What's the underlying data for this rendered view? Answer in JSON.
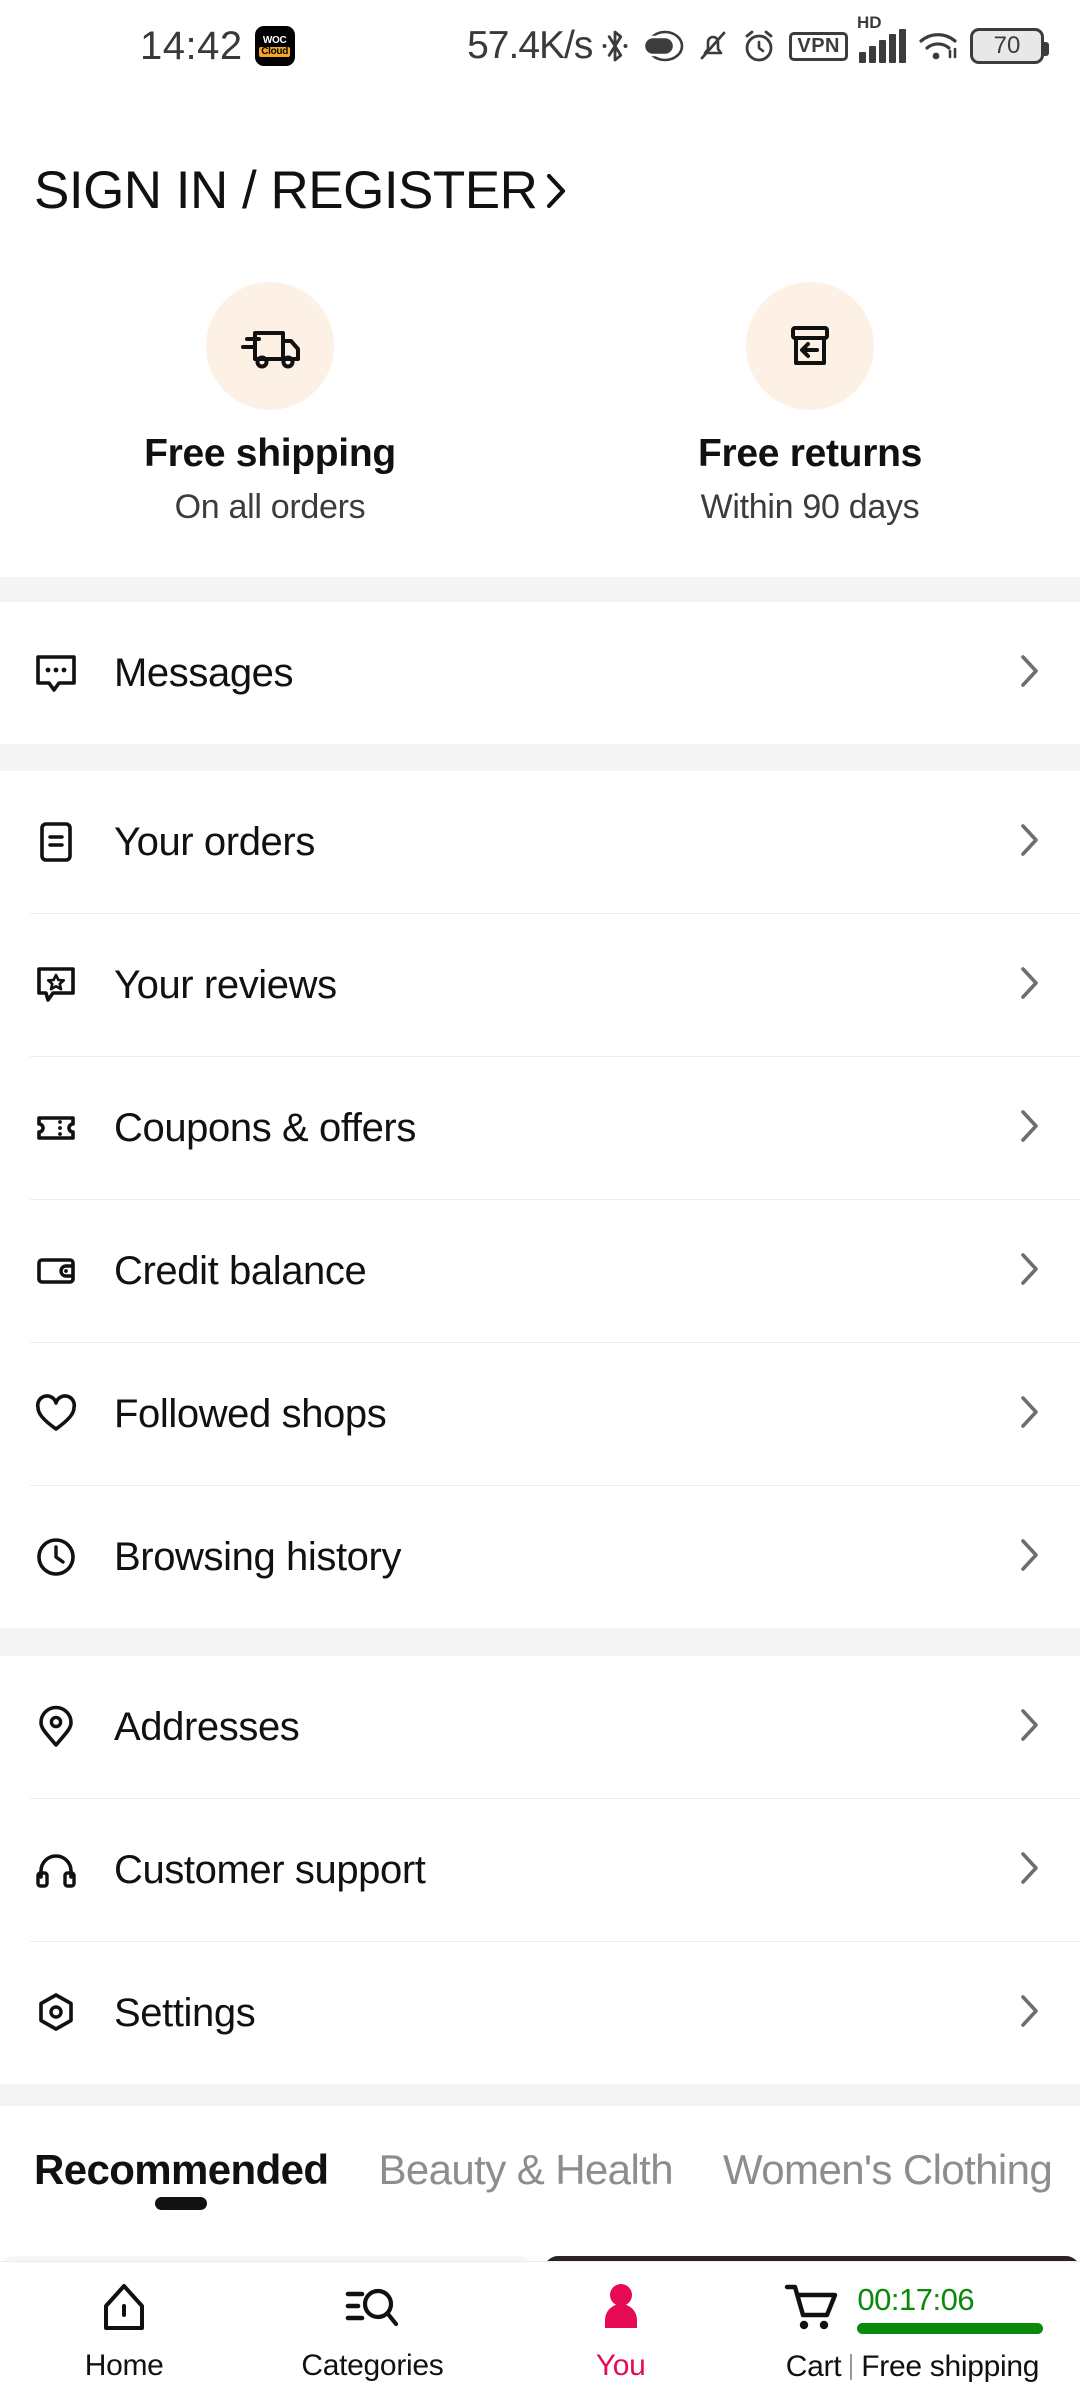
{
  "statusbar": {
    "time": "14:42",
    "badge_line1": "WOC",
    "badge_line2": "Cloud",
    "network_speed": "57.4K/s",
    "vpn_label": "VPN",
    "hd_label": "HD",
    "battery_level": "70",
    "icons": [
      "bluetooth-icon",
      "capsule-icon",
      "silent-bell-icon",
      "alarm-icon",
      "vpn-icon",
      "signal-icon",
      "wifi-icon",
      "battery-icon"
    ]
  },
  "header": {
    "sign_in_label": "SIGN IN / REGISTER"
  },
  "benefits": [
    {
      "icon": "delivery-truck-icon",
      "title": "Free shipping",
      "subtitle": "On all orders"
    },
    {
      "icon": "return-box-icon",
      "title": "Free returns",
      "subtitle": "Within 90 days"
    }
  ],
  "menu_groups": [
    {
      "items": [
        {
          "icon": "message-bubble-icon",
          "label": "Messages"
        }
      ]
    },
    {
      "items": [
        {
          "icon": "order-document-icon",
          "label": "Your orders"
        },
        {
          "icon": "review-star-bubble-icon",
          "label": "Your reviews"
        },
        {
          "icon": "coupon-ticket-icon",
          "label": "Coupons & offers"
        },
        {
          "icon": "wallet-icon",
          "label": "Credit balance"
        },
        {
          "icon": "heart-icon",
          "label": "Followed shops"
        },
        {
          "icon": "clock-icon",
          "label": "Browsing history"
        }
      ]
    },
    {
      "items": [
        {
          "icon": "location-pin-icon",
          "label": "Addresses"
        },
        {
          "icon": "headset-icon",
          "label": "Customer support"
        },
        {
          "icon": "settings-gear-icon",
          "label": "Settings"
        }
      ]
    }
  ],
  "tabs": [
    {
      "label": "Recommended",
      "active": true
    },
    {
      "label": "Beauty & Health",
      "active": false
    },
    {
      "label": "Women's Clothing",
      "active": false
    }
  ],
  "bottom_nav": {
    "items": [
      {
        "icon": "home-icon",
        "label": "Home",
        "active": false
      },
      {
        "icon": "categories-search-icon",
        "label": "Categories",
        "active": false
      },
      {
        "icon": "person-icon",
        "label": "You",
        "active": true
      }
    ],
    "cart": {
      "icon": "shopping-cart-icon",
      "timer": "00:17:06",
      "label": "Cart",
      "promo_label": "Free shipping"
    }
  },
  "colors": {
    "accent_pink": "#e60a54",
    "timer_green": "#0a8a0a",
    "benefit_circle": "#fdf1e6",
    "band_gray": "#f4f4f4",
    "divider": "#ededed",
    "chevron": "#6e6e6e"
  }
}
